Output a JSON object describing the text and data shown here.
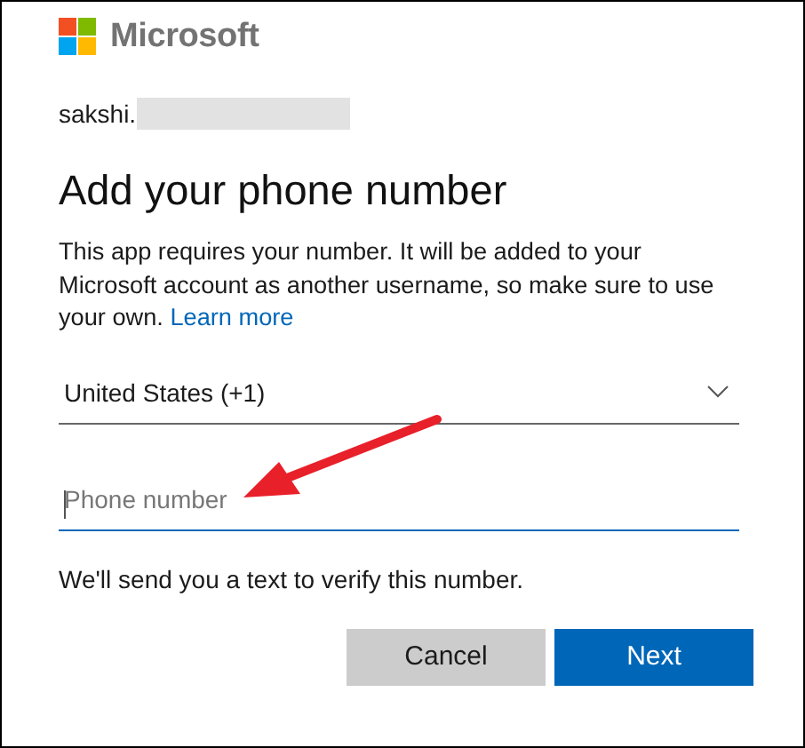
{
  "brand": {
    "name": "Microsoft"
  },
  "account": {
    "username": "sakshi."
  },
  "heading": "Add your phone number",
  "description": {
    "text": "This app requires your number. It will be added to your Microsoft account as another username, so make sure to use your own.",
    "link": "Learn more"
  },
  "country_select": {
    "value": "United States (+1)"
  },
  "phone_field": {
    "placeholder": "Phone number",
    "focused": true
  },
  "note": "We'll send you a text to verify this number.",
  "buttons": [
    {
      "label": "Cancel",
      "kind": "secondary"
    },
    {
      "label": "Next",
      "kind": "primary"
    }
  ]
}
